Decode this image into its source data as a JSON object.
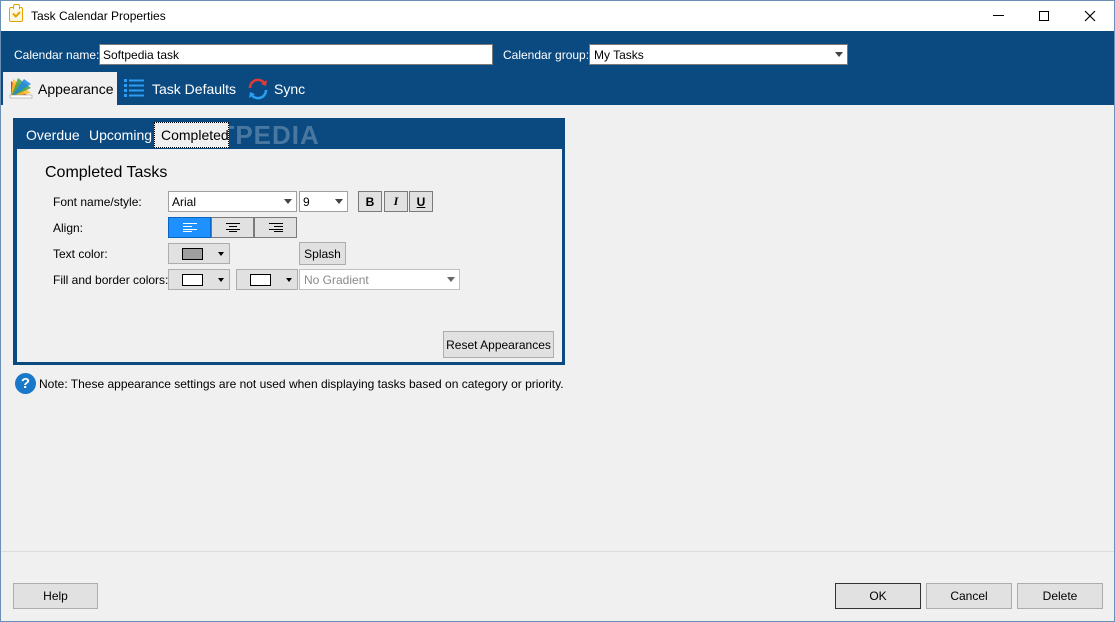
{
  "window": {
    "title": "Task Calendar Properties"
  },
  "header": {
    "calendar_name_label": "Calendar name:",
    "calendar_name_value": "Softpedia task",
    "calendar_group_label": "Calendar group:",
    "calendar_group_value": "My Tasks"
  },
  "tabs": [
    {
      "label": "Appearance",
      "icon": "palette-icon",
      "active": true
    },
    {
      "label": "Task Defaults",
      "icon": "list-icon",
      "active": false
    },
    {
      "label": "Sync",
      "icon": "sync-icon",
      "active": false
    }
  ],
  "subtabs": [
    {
      "label": "Overdue",
      "active": false
    },
    {
      "label": "Upcoming",
      "active": false
    },
    {
      "label": "Completed",
      "active": true
    }
  ],
  "watermark": "SOFTPEDIA",
  "section": {
    "title": "Completed Tasks",
    "font_label": "Font name/style:",
    "font_name": "Arial",
    "font_size": "9",
    "bold": "B",
    "italic": "I",
    "underline": "U",
    "align_label": "Align:",
    "align_selected": "left",
    "text_color_label": "Text color:",
    "text_color": "#9f9f9f",
    "splash_label": "Splash",
    "fill_label": "Fill and border colors:",
    "fill_color": "#ffffff",
    "border_color": "#ffffff",
    "gradient_value": "No Gradient",
    "reset_label": "Reset Appearances"
  },
  "note": "Note: These appearance settings are not used when displaying tasks based on category or priority.",
  "footer": {
    "help": "Help",
    "ok": "OK",
    "cancel": "Cancel",
    "delete": "Delete"
  },
  "colors": {
    "header_blue": "#0b4a80",
    "selected_align": "#1e90ff"
  }
}
